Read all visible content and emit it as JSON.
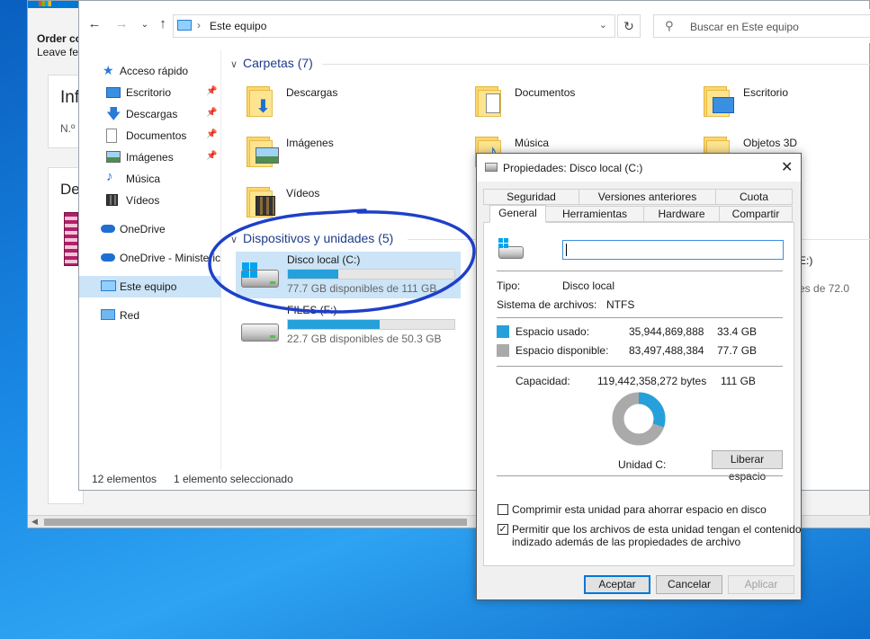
{
  "background_app": {
    "order_text": "Order co",
    "leave_text": "Leave fe",
    "inf_text": "Inf",
    "no_text": "N.º",
    "de_text": "De"
  },
  "explorer": {
    "address": "Este equipo",
    "search_placeholder": "Buscar en Este equipo",
    "sidebar": [
      {
        "label": "Acceso rápido",
        "icon": "star-icon",
        "pinned": false
      },
      {
        "label": "Escritorio",
        "icon": "desktop-icon",
        "pinned": true
      },
      {
        "label": "Descargas",
        "icon": "download-icon",
        "pinned": true
      },
      {
        "label": "Documentos",
        "icon": "document-icon",
        "pinned": true
      },
      {
        "label": "Imágenes",
        "icon": "pictures-icon",
        "pinned": true
      },
      {
        "label": "Música",
        "icon": "music-icon",
        "pinned": false
      },
      {
        "label": "Vídeos",
        "icon": "video-icon",
        "pinned": false
      },
      {
        "label": "OneDrive",
        "icon": "cloud-icon",
        "pinned": false
      },
      {
        "label": "OneDrive - Ministeric",
        "icon": "cloud-icon",
        "pinned": false
      },
      {
        "label": "Este equipo",
        "icon": "computer-icon",
        "pinned": false,
        "selected": true
      },
      {
        "label": "Red",
        "icon": "network-icon",
        "pinned": false
      }
    ],
    "folders_header": "Carpetas (7)",
    "folders": [
      "Descargas",
      "Documentos",
      "Escritorio",
      "Imágenes",
      "Música",
      "Objetos 3D",
      "Vídeos"
    ],
    "devices_header": "Dispositivos y unidades (5)",
    "drives": [
      {
        "label": "Disco local (C:)",
        "free_text": "77.7 GB disponibles de 111 GB",
        "used_fraction": 0.3,
        "selected": true
      },
      {
        "label": "FILES (F:)",
        "free_text": "22.7 GB disponibles de 50.3 GB",
        "used_fraction": 0.55,
        "selected": false
      }
    ],
    "partial_drive_label": "E:)",
    "partial_drive_free": "ibles de 72.0",
    "status_count": "12 elementos",
    "status_selected": "1 elemento seleccionado"
  },
  "dialog": {
    "title": "Propiedades: Disco local (C:)",
    "close_glyph": "✕",
    "tabs_row1": [
      "Seguridad",
      "Versiones anteriores",
      "Cuota"
    ],
    "tabs_row2": [
      "General",
      "Herramientas",
      "Hardware",
      "Compartir"
    ],
    "name_value": "",
    "type_label": "Tipo:",
    "type_value": "Disco local",
    "fs_label": "Sistema de archivos:",
    "fs_value": "NTFS",
    "used_label": "Espacio usado:",
    "used_bytes": "35,944,869,888",
    "used_gb": "33.4 GB",
    "free_label": "Espacio disponible:",
    "free_bytes": "83,497,488,384",
    "free_gb": "77.7 GB",
    "capacity_label": "Capacidad:",
    "capacity_bytes": "119,442,358,272 bytes",
    "capacity_gb": "111 GB",
    "unit_label": "Unidad C:",
    "free_space_button": "Liberar espacio",
    "compress_label": "Comprimir esta unidad para ahorrar espacio en disco",
    "compress_checked": false,
    "index_label_1": "Permitir que los archivos de esta unidad tengan el contenido",
    "index_label_2": "indizado además de las propiedades de archivo",
    "index_checked": true,
    "ok_button": "Aceptar",
    "cancel_button": "Cancelar",
    "apply_button": "Aplicar",
    "used_fraction": 0.301,
    "colors": {
      "used": "#26a0da",
      "free": "#aaaaaa"
    }
  }
}
